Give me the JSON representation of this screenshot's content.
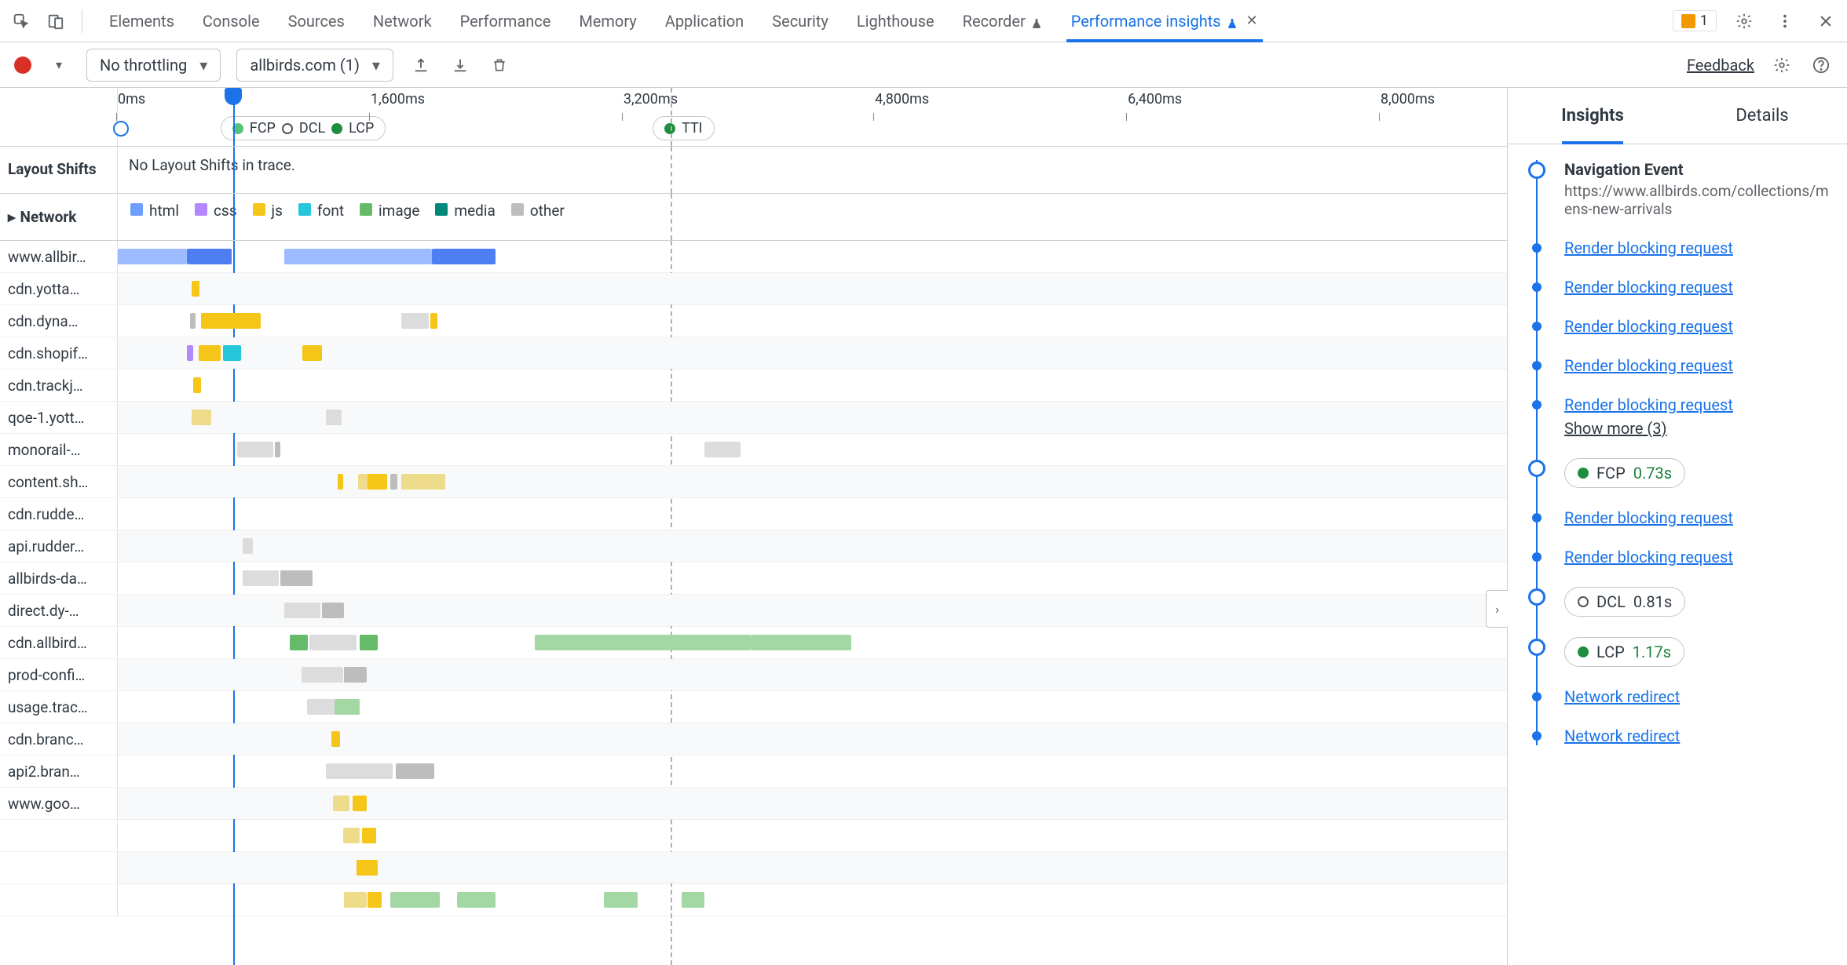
{
  "tabbar": {
    "tabs": [
      "Elements",
      "Console",
      "Sources",
      "Network",
      "Performance",
      "Memory",
      "Application",
      "Security",
      "Lighthouse",
      "Recorder",
      "Performance insights"
    ],
    "activeIndex": 10,
    "issuesCount": "1"
  },
  "toolbar": {
    "throttling": "No throttling",
    "recording": "allbirds.com (1)",
    "feedback": "Feedback"
  },
  "timeline": {
    "ticks": [
      {
        "label": "0ms",
        "pct": 0
      },
      {
        "label": "1,600ms",
        "pct": 18.2
      },
      {
        "label": "3,200ms",
        "pct": 36.4
      },
      {
        "label": "4,800ms",
        "pct": 54.5
      },
      {
        "label": "6,400ms",
        "pct": 72.7
      },
      {
        "label": "8,000ms",
        "pct": 90.9
      }
    ],
    "playheadPct": 8.3,
    "dashedPct": 39.8,
    "markers": {
      "fcpdcllcp": {
        "leftPct": 7.4,
        "items": [
          {
            "kind": "lgreen",
            "label": "FCP"
          },
          {
            "kind": "ring",
            "label": "DCL"
          },
          {
            "kind": "green",
            "label": "LCP"
          }
        ]
      },
      "tti": {
        "leftPct": 38.5,
        "label": "TTI"
      }
    }
  },
  "layoutShifts": {
    "title": "Layout Shifts",
    "text": "No Layout Shifts in trace."
  },
  "networkSection": {
    "title": "Network",
    "legend": [
      {
        "name": "html",
        "color": "#6e9eff"
      },
      {
        "name": "css",
        "color": "#b388ff"
      },
      {
        "name": "js",
        "color": "#f5c518"
      },
      {
        "name": "font",
        "color": "#26c6da"
      },
      {
        "name": "image",
        "color": "#66bb6a"
      },
      {
        "name": "media",
        "color": "#00897b"
      },
      {
        "name": "other",
        "color": "#bdbdbd"
      }
    ],
    "rows": [
      {
        "host": "www.allbir…",
        "bars": [
          {
            "l": 0,
            "w": 5,
            "c": "#9cbcff"
          },
          {
            "l": 5,
            "w": 3.2,
            "c": "#4f7ef2"
          },
          {
            "l": 12,
            "w": 10.6,
            "c": "#9cbcff"
          },
          {
            "l": 22.6,
            "w": 4.6,
            "c": "#4f7ef2"
          }
        ]
      },
      {
        "host": "cdn.yotta…",
        "bars": [
          {
            "l": 5.3,
            "w": 0.6,
            "c": "#f5c518"
          }
        ]
      },
      {
        "host": "cdn.dyna…",
        "bars": [
          {
            "l": 5.2,
            "w": 0.4,
            "c": "#bdbdbd"
          },
          {
            "l": 6,
            "w": 4.3,
            "c": "#f5c518"
          },
          {
            "l": 20.4,
            "w": 2,
            "c": "#dcdcdc"
          },
          {
            "l": 22.5,
            "w": 0.5,
            "c": "#f5c518"
          }
        ]
      },
      {
        "host": "cdn.shopif…",
        "bars": [
          {
            "l": 5,
            "w": 0.4,
            "c": "#b388ff"
          },
          {
            "l": 5.8,
            "w": 1.6,
            "c": "#f5c518"
          },
          {
            "l": 7.6,
            "w": 1.3,
            "c": "#26c6da"
          },
          {
            "l": 13.3,
            "w": 1.4,
            "c": "#f5c518"
          }
        ]
      },
      {
        "host": "cdn.trackj…",
        "bars": [
          {
            "l": 5.4,
            "w": 0.6,
            "c": "#f5c518"
          }
        ]
      },
      {
        "host": "qoe-1.yott…",
        "bars": [
          {
            "l": 5.3,
            "w": 1.4,
            "c": "#eedc8a"
          },
          {
            "l": 15,
            "w": 1.1,
            "c": "#dcdcdc"
          }
        ]
      },
      {
        "host": "monorail-…",
        "bars": [
          {
            "l": 8.6,
            "w": 2.6,
            "c": "#dcdcdc"
          },
          {
            "l": 11.3,
            "w": 0.4,
            "c": "#bdbdbd"
          },
          {
            "l": 42.2,
            "w": 2.6,
            "c": "#dcdcdc"
          }
        ]
      },
      {
        "host": "content.sh…",
        "bars": [
          {
            "l": 15.8,
            "w": 0.4,
            "c": "#f5c518"
          },
          {
            "l": 17.3,
            "w": 2,
            "c": "#eedc8a"
          },
          {
            "l": 18,
            "w": 1.4,
            "c": "#f5c518"
          },
          {
            "l": 19.6,
            "w": 0.5,
            "c": "#bdbdbd"
          },
          {
            "l": 20.4,
            "w": 3.2,
            "c": "#eedc8a"
          }
        ]
      },
      {
        "host": "cdn.rudde…",
        "bars": []
      },
      {
        "host": "api.rudder…",
        "bars": [
          {
            "l": 9,
            "w": 0.7,
            "c": "#dcdcdc"
          }
        ]
      },
      {
        "host": "allbirds-da…",
        "bars": [
          {
            "l": 9,
            "w": 2.6,
            "c": "#dcdcdc"
          },
          {
            "l": 11.7,
            "w": 2.3,
            "c": "#bdbdbd"
          }
        ]
      },
      {
        "host": "direct.dy-…",
        "bars": [
          {
            "l": 12,
            "w": 2.6,
            "c": "#dcdcdc"
          },
          {
            "l": 14.7,
            "w": 1.6,
            "c": "#bdbdbd"
          }
        ]
      },
      {
        "host": "cdn.allbird…",
        "bars": [
          {
            "l": 12.4,
            "w": 1.3,
            "c": "#66bb6a"
          },
          {
            "l": 13.8,
            "w": 3.4,
            "c": "#dcdcdc"
          },
          {
            "l": 17.4,
            "w": 1.3,
            "c": "#66bb6a"
          },
          {
            "l": 30,
            "w": 15.6,
            "c": "#a3d8a5"
          },
          {
            "l": 45.6,
            "w": 7.2,
            "c": "#a3d8a5"
          }
        ]
      },
      {
        "host": "prod-confi…",
        "bars": [
          {
            "l": 13.2,
            "w": 3,
            "c": "#dcdcdc"
          },
          {
            "l": 16.3,
            "w": 1.6,
            "c": "#bdbdbd"
          }
        ]
      },
      {
        "host": "usage.trac…",
        "bars": [
          {
            "l": 13.6,
            "w": 2.8,
            "c": "#dcdcdc"
          },
          {
            "l": 15.6,
            "w": 1.8,
            "c": "#a3d8a5"
          }
        ]
      },
      {
        "host": "cdn.branc…",
        "bars": [
          {
            "l": 15.4,
            "w": 0.6,
            "c": "#f5c518"
          }
        ]
      },
      {
        "host": "api2.bran…",
        "bars": [
          {
            "l": 15,
            "w": 4.8,
            "c": "#dcdcdc"
          },
          {
            "l": 20,
            "w": 2.8,
            "c": "#bdbdbd"
          }
        ]
      },
      {
        "host": "www.goo…",
        "bars": [
          {
            "l": 15.5,
            "w": 1.2,
            "c": "#eedc8a"
          },
          {
            "l": 16.9,
            "w": 1,
            "c": "#f5c518"
          }
        ]
      },
      {
        "host": "",
        "bars": [
          {
            "l": 16.2,
            "w": 1.2,
            "c": "#eedc8a"
          },
          {
            "l": 17.6,
            "w": 1,
            "c": "#f5c518"
          }
        ]
      },
      {
        "host": "",
        "bars": [
          {
            "l": 17.2,
            "w": 1.5,
            "c": "#f5c518"
          }
        ]
      },
      {
        "host": "",
        "bars": [
          {
            "l": 16.3,
            "w": 1.6,
            "c": "#eedc8a"
          },
          {
            "l": 18,
            "w": 1,
            "c": "#f5c518"
          },
          {
            "l": 19.6,
            "w": 3.6,
            "c": "#a3d8a5"
          },
          {
            "l": 24.4,
            "w": 2.8,
            "c": "#a3d8a5"
          },
          {
            "l": 35,
            "w": 2.4,
            "c": "#a3d8a5"
          },
          {
            "l": 40.6,
            "w": 1.6,
            "c": "#a3d8a5"
          }
        ]
      }
    ]
  },
  "insights": {
    "tabs": [
      "Insights",
      "Details"
    ],
    "activeTab": 0,
    "items": [
      {
        "node": "big",
        "type": "title",
        "title": "Navigation Event",
        "sub": "https://www.allbirds.com/collections/mens-new-arrivals"
      },
      {
        "node": "small",
        "type": "link",
        "text": "Render blocking request"
      },
      {
        "node": "small",
        "type": "link",
        "text": "Render blocking request"
      },
      {
        "node": "small",
        "type": "link",
        "text": "Render blocking request"
      },
      {
        "node": "small",
        "type": "link",
        "text": "Render blocking request"
      },
      {
        "node": "small",
        "type": "linkmore",
        "text": "Render blocking request",
        "more": "Show more (3)"
      },
      {
        "node": "big",
        "type": "chip",
        "chip": {
          "dot": "green",
          "label": "FCP",
          "value": "0.73s"
        }
      },
      {
        "node": "small",
        "type": "link",
        "text": "Render blocking request"
      },
      {
        "node": "small",
        "type": "link",
        "text": "Render blocking request"
      },
      {
        "node": "big",
        "type": "chip",
        "chip": {
          "dot": "ring",
          "label": "DCL",
          "value": "0.81s",
          "cls": "dcl"
        }
      },
      {
        "node": "big",
        "type": "chip",
        "chip": {
          "dot": "green",
          "label": "LCP",
          "value": "1.17s"
        }
      },
      {
        "node": "small",
        "type": "link",
        "text": "Network redirect"
      },
      {
        "node": "small",
        "type": "link",
        "text": "Network redirect"
      }
    ]
  }
}
